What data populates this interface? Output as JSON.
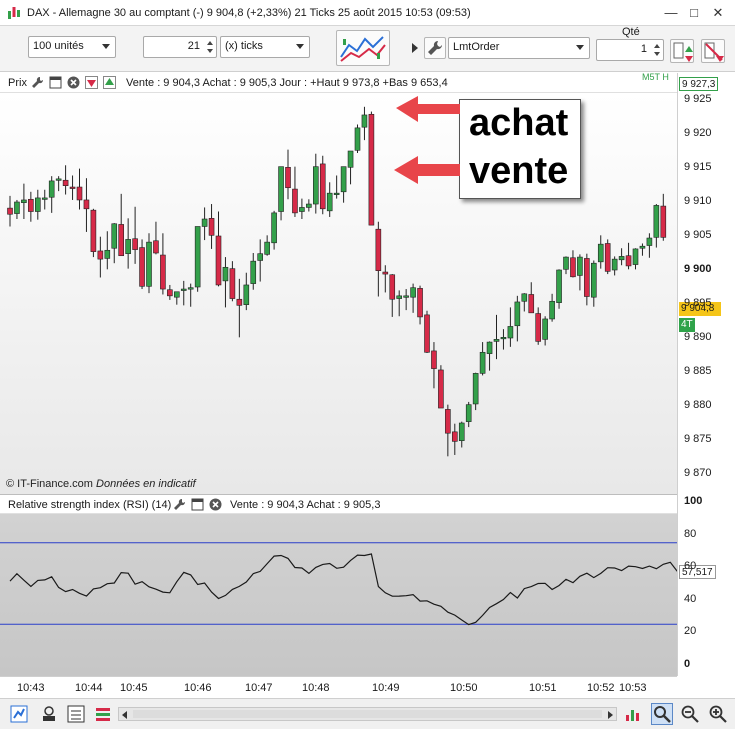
{
  "window": {
    "title": "DAX - Allemagne 30 au comptant (-)   9 904,8 (+2,33%)   21 Ticks  25 août 2015 10:53 (09:53)",
    "icon": "chart-app-icon",
    "minimize_label": "—",
    "maximize_label": "□",
    "close_label": "✕"
  },
  "toolbar": {
    "units_select": "100 unités",
    "ticks_value": "21",
    "ticks_unit_select": "(x) ticks",
    "order_type_select": "LmtOrder",
    "qty_label": "Qté",
    "qty_value": "1",
    "indicator_button_icon": "indicators-icon",
    "wrench_icon": "wrench-icon",
    "buy_icon": "buy-order-icon",
    "sell_icon": "sell-order-icon"
  },
  "price_panel": {
    "label": "Prix",
    "quote_line": "Vente : 9 904,3 Achat : 9 905,3 Jour : +Haut 9 973,8 +Bas 9 653,4",
    "watermark": "© IT-Finance.com",
    "watermark_note": "Données en indicatif",
    "axis_ticks": [
      "9 925",
      "9 920",
      "9 915",
      "9 910",
      "9 905",
      "9 900",
      "9 895",
      "9 890",
      "9 885",
      "9 880",
      "9 875",
      "9 870"
    ],
    "top_badge": "9 927,3",
    "top_badge_corner": "M5T H",
    "current_price_badge": "9 904,8",
    "ticks_badge": "4T",
    "bold_tick": "9 900"
  },
  "annotations": {
    "upper": "achat",
    "lower": "vente",
    "arrow_color": "#e8454a"
  },
  "rsi_panel": {
    "label": "Relative strength index (RSI) (14)",
    "quote_line": "Vente : 9 904,3 Achat : 9 905,3",
    "axis_ticks": [
      "100",
      "80",
      "60",
      "40",
      "20",
      "0"
    ],
    "current_value": "57,517",
    "upper_band": 75,
    "lower_band": 25,
    "line_color": "#1a1a1a",
    "band_color": "#2b3fc9"
  },
  "time_axis": {
    "labels": [
      "10:43",
      "10:44",
      "10:45",
      "10:46",
      "10:47",
      "10:48",
      "10:49",
      "10:50",
      "10:51",
      "10:52",
      "10:53"
    ]
  },
  "colors": {
    "bullish": "#33a04a",
    "bearish": "#d62a48",
    "current_badge_bg": "#f5c518",
    "ticks_badge_bg": "#2fa34a"
  },
  "candles": [
    [
      9909.1,
      9910.9,
      9906.4,
      9908.2
    ],
    [
      9908.3,
      9910.3,
      9907.5,
      9910.0
    ],
    [
      9909.9,
      9912.7,
      9907.5,
      9910.3
    ],
    [
      9910.4,
      9911.5,
      9907.1,
      9908.6
    ],
    [
      9908.6,
      9911.8,
      9907.4,
      9910.6
    ],
    [
      9910.5,
      9911.8,
      9908.9,
      9910.6
    ],
    [
      9910.7,
      9913.8,
      9908.4,
      9913.1
    ],
    [
      9913.3,
      9913.8,
      9911.6,
      9913.4
    ],
    [
      9913.2,
      9915.4,
      9911.1,
      9912.4
    ],
    [
      9912.2,
      9913.9,
      9910.3,
      9912.1
    ],
    [
      9912.2,
      9914.9,
      9908.9,
      9910.3
    ],
    [
      9910.3,
      9913.5,
      9905.6,
      9909.0
    ],
    [
      9908.8,
      9909.0,
      9901.9,
      9902.7
    ],
    [
      9902.8,
      9904.9,
      9898.9,
      9901.6
    ],
    [
      9901.7,
      9905.7,
      9900.1,
      9902.9
    ],
    [
      9903.2,
      9906.9,
      9901.0,
      9906.8
    ],
    [
      9906.7,
      9911.2,
      9903.2,
      9902.1
    ],
    [
      9902.4,
      9907.6,
      9900.2,
      9904.5
    ],
    [
      9904.6,
      9909.3,
      9900.9,
      9903.0
    ],
    [
      9903.3,
      9904.5,
      9897.2,
      9897.6
    ],
    [
      9897.6,
      9905.4,
      9896.6,
      9904.1
    ],
    [
      9904.3,
      9907.1,
      9902.3,
      9902.5
    ],
    [
      9902.2,
      9905.4,
      9896.4,
      9897.2
    ],
    [
      9897.1,
      9897.8,
      9895.6,
      9896.2
    ],
    [
      9896.0,
      9896.8,
      9894.9,
      9896.8
    ],
    [
      9897.2,
      9898.4,
      9894.8,
      9897.2
    ],
    [
      9897.4,
      9898.0,
      9894.6,
      9897.4
    ],
    [
      9897.5,
      9906.4,
      9896.8,
      9906.4
    ],
    [
      9906.4,
      9909.2,
      9904.4,
      9907.5
    ],
    [
      9907.6,
      9909.7,
      9903.1,
      9905.1
    ],
    [
      9905.0,
      9908.6,
      9897.6,
      9897.8
    ],
    [
      9898.4,
      9901.9,
      9894.5,
      9900.4
    ],
    [
      9900.2,
      9901.3,
      9895.4,
      9895.8
    ],
    [
      9895.7,
      9898.7,
      9890.1,
      9894.8
    ],
    [
      9894.9,
      9899.6,
      9894.1,
      9897.8
    ],
    [
      9898.0,
      9902.5,
      9897.1,
      9901.3
    ],
    [
      9901.4,
      9904.5,
      9898.3,
      9902.4
    ],
    [
      9902.3,
      9905.1,
      9902.1,
      9904.1
    ],
    [
      9904.0,
      9908.7,
      9903.0,
      9908.4
    ],
    [
      9908.6,
      9913.0,
      9907.3,
      9915.2
    ],
    [
      9915.1,
      9917.7,
      9910.4,
      9912.1
    ],
    [
      9911.9,
      9915.2,
      9907.8,
      9908.4
    ],
    [
      9908.6,
      9910.5,
      9907.5,
      9909.2
    ],
    [
      9909.2,
      9910.4,
      9908.6,
      9909.7
    ],
    [
      9909.7,
      9917.1,
      9908.3,
      9915.2
    ],
    [
      9915.6,
      9916.8,
      9908.2,
      9909.0
    ],
    [
      9908.7,
      9912.9,
      9907.8,
      9911.3
    ],
    [
      9911.2,
      9913.9,
      9910.5,
      9911.3
    ],
    [
      9911.5,
      9915.1,
      9909.9,
      9915.2
    ],
    [
      9915.1,
      9917.4,
      9912.6,
      9917.5
    ],
    [
      9917.6,
      9921.4,
      9917.2,
      9920.9
    ],
    [
      9921.0,
      9924.0,
      9919.1,
      9922.8
    ],
    [
      9922.9,
      9923.3,
      9913.2,
      9906.6
    ],
    [
      9906.0,
      9907.1,
      9896.1,
      9899.9
    ],
    [
      9899.7,
      9900.7,
      9896.7,
      9899.4
    ],
    [
      9899.3,
      9899.4,
      9893.1,
      9895.7
    ],
    [
      9895.8,
      9897.0,
      9893.2,
      9896.2
    ],
    [
      9896.2,
      9897.2,
      9894.1,
      9896.2
    ],
    [
      9896.0,
      9898.0,
      9893.7,
      9897.4
    ],
    [
      9897.3,
      9897.7,
      9892.0,
      9893.1
    ],
    [
      9893.4,
      9894.0,
      9887.8,
      9887.9
    ],
    [
      9888.1,
      9889.4,
      9882.6,
      9885.5
    ],
    [
      9885.3,
      9886.0,
      9881.5,
      9879.7
    ],
    [
      9879.5,
      9880.2,
      9872.6,
      9876.0
    ],
    [
      9876.2,
      9877.4,
      9872.8,
      9874.8
    ],
    [
      9874.9,
      9877.7,
      9873.9,
      9877.5
    ],
    [
      9877.7,
      9880.6,
      9876.9,
      9880.2
    ],
    [
      9880.3,
      9884.9,
      9879.4,
      9884.8
    ],
    [
      9884.8,
      9889.4,
      9884.5,
      9887.9
    ],
    [
      9887.7,
      9889.5,
      9885.2,
      9889.4
    ],
    [
      9889.5,
      9893.4,
      9886.9,
      9889.8
    ],
    [
      9889.9,
      9891.3,
      9888.3,
      9890.1
    ],
    [
      9890.0,
      9894.5,
      9888.7,
      9891.7
    ],
    [
      9891.8,
      9896.2,
      9889.5,
      9895.3
    ],
    [
      9895.4,
      9896.6,
      9893.9,
      9896.5
    ],
    [
      9896.4,
      9898.2,
      9893.7,
      9893.7
    ],
    [
      9893.6,
      9894.5,
      9889.0,
      9889.5
    ],
    [
      9889.8,
      9893.2,
      9888.9,
      9892.8
    ],
    [
      9892.8,
      9896.5,
      9892.4,
      9895.4
    ],
    [
      9895.2,
      9900.1,
      9894.3,
      9900.0
    ],
    [
      9900.1,
      9902.0,
      9899.4,
      9901.9
    ],
    [
      9901.8,
      9902.9,
      9898.9,
      9899.0
    ],
    [
      9899.2,
      9902.3,
      9897.0,
      9901.9
    ],
    [
      9901.7,
      9902.4,
      9894.8,
      9896.1
    ],
    [
      9896.0,
      9901.4,
      9894.6,
      9901.0
    ],
    [
      9901.2,
      9905.1,
      9900.2,
      9903.8
    ],
    [
      9903.9,
      9904.5,
      9899.4,
      9899.8
    ],
    [
      9900.0,
      9902.0,
      9899.2,
      9901.6
    ],
    [
      9901.5,
      9903.2,
      9900.7,
      9902.0
    ],
    [
      9902.1,
      9904.0,
      9900.1,
      9900.6
    ],
    [
      9900.8,
      9903.2,
      9900.1,
      9903.1
    ],
    [
      9903.2,
      9903.9,
      9902.1,
      9903.5
    ],
    [
      9903.6,
      9905.4,
      9901.8,
      9904.7
    ],
    [
      9904.8,
      9909.7,
      9903.3,
      9909.5
    ],
    [
      9909.4,
      9911.2,
      9904.3,
      9904.8
    ]
  ],
  "rsi": [
    51.5,
    56.0,
    52.0,
    48.2,
    51.9,
    52.2,
    54.1,
    47.6,
    45.0,
    46.3,
    44.0,
    42.3,
    46.7,
    47.4,
    49.9,
    50.3,
    56.7,
    56.3,
    49.6,
    51.1,
    48.0,
    46.5,
    44.7,
    44.3,
    51.1,
    56.8,
    55.3,
    49.4,
    50.3,
    44.7,
    40.8,
    42.7,
    46.4,
    48.2,
    50.9,
    56.1,
    57.4,
    62.2,
    66.8,
    67.2,
    65.4,
    59.8,
    59.5,
    56.2,
    59.9,
    61.7,
    62.3,
    59.3,
    60.0,
    64.2,
    67.4,
    67.2,
    68.1,
    48.1,
    44.3,
    42.2,
    42.3,
    42.5,
    43.2,
    39.2,
    39.4,
    37.3,
    36.0,
    32.4,
    30.6,
    27.6,
    24.8,
    26.2,
    30.4,
    35.3,
    37.6,
    40.2,
    44.5,
    41.1,
    46.9,
    48.1,
    50.0,
    50.1,
    46.3,
    48.8,
    52.6,
    50.5,
    54.4,
    56.3,
    53.6,
    56.2,
    59.7,
    59.5,
    57.9,
    60.7,
    60.3,
    59.2,
    60.7,
    59.1,
    61.8,
    63.0,
    57.5
  ]
}
